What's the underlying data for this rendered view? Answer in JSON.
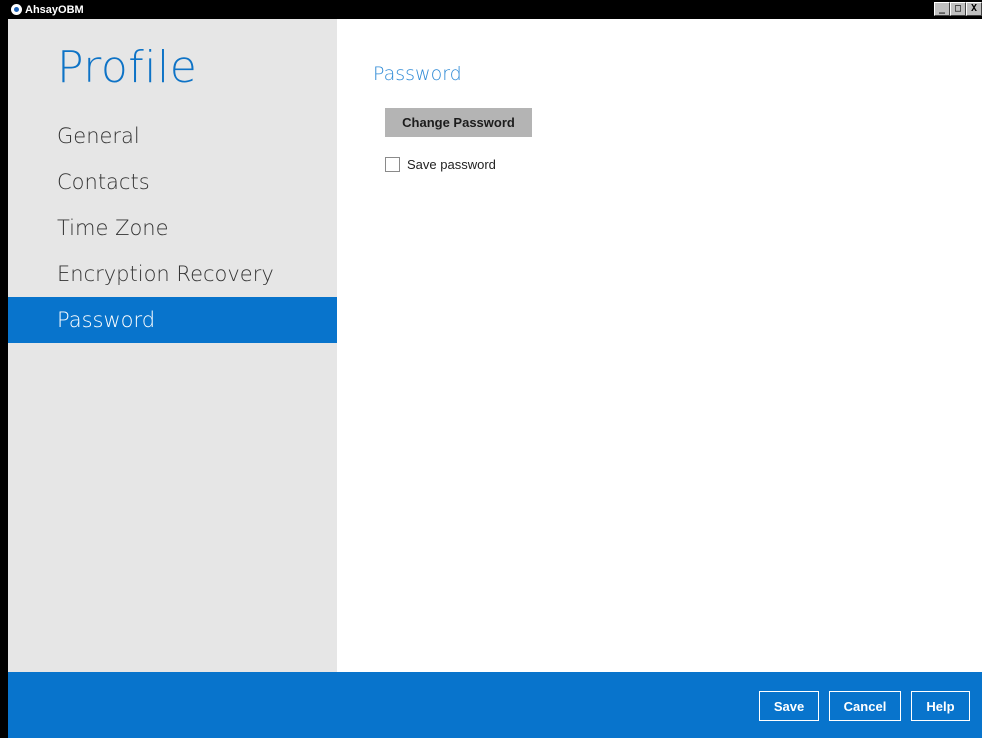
{
  "window": {
    "title": "AhsayOBM",
    "controls": {
      "minimize": "_",
      "maximize": "□",
      "close": "X"
    }
  },
  "sidebar": {
    "heading": "Profile",
    "items": [
      {
        "label": "General"
      },
      {
        "label": "Contacts"
      },
      {
        "label": "Time Zone"
      },
      {
        "label": "Encryption Recovery"
      },
      {
        "label": "Password",
        "active": true
      }
    ]
  },
  "main": {
    "section_title": "Password",
    "change_password_label": "Change Password",
    "save_password_label": "Save password",
    "save_password_checked": false
  },
  "footer": {
    "save_label": "Save",
    "cancel_label": "Cancel",
    "help_label": "Help"
  },
  "colors": {
    "accent": "#0874cc",
    "sidebar_bg": "#e6e6e6",
    "heading": "#0e73c6"
  },
  "icons": {
    "app_logo": "ahsay-logo-icon"
  }
}
